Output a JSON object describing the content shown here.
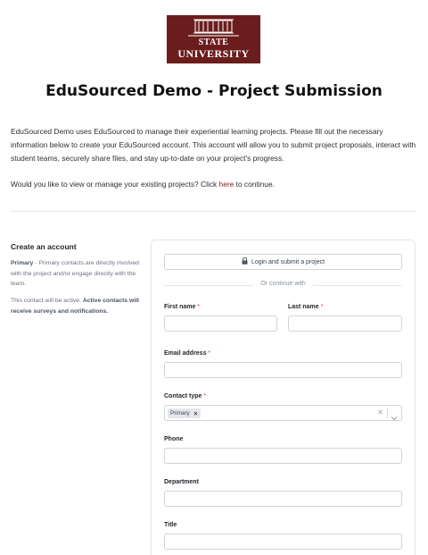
{
  "logo": {
    "line1": "STATE",
    "line2": "UNIVERSITY",
    "bg": "#6b1d1d"
  },
  "page": {
    "title": "EduSourced Demo - Project Submission",
    "intro": "EduSourced Demo uses EduSourced to manage their experiential learning projects. Please fill out the necessary information below to create your EduSourced account. This account will allow you to submit project proposals, interact with student teams, securely share files, and stay up-to-date on your project's progress.",
    "question_prefix": "Would you like to view or manage your existing projects? Click ",
    "question_link": "here",
    "question_suffix": " to continue."
  },
  "sidebar": {
    "title": "Create an account",
    "primary_label": "Primary",
    "primary_desc": " - Primary contacts are directly involved with the project and/or engage directly with the team.",
    "note_prefix": "This contact will be active. ",
    "note_bold": "Active contacts will receive surveys and notifications."
  },
  "form": {
    "login_button": "Login and submit a project",
    "or_text": "Or continue with",
    "first_name_label": "First name",
    "last_name_label": "Last name",
    "email_label": "Email address",
    "contact_type_label": "Contact type",
    "contact_type_value": "Primary",
    "phone_label": "Phone",
    "department_label": "Department",
    "title_label": "Title",
    "required_mark": "*"
  },
  "colors": {
    "accent": "#8a1c1c",
    "required": "#d0453b",
    "border": "#cfd4d9"
  },
  "icons": {
    "lock": "lock-icon",
    "chevron": "chevron-down-icon",
    "clear": "clear-icon",
    "chip_remove": "remove-icon"
  }
}
